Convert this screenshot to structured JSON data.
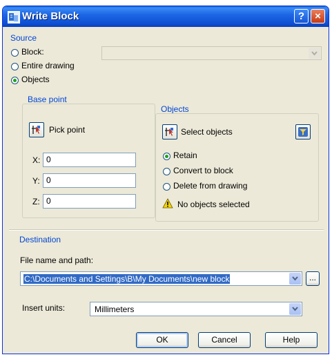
{
  "window": {
    "title": "Write Block",
    "help_label": "?",
    "close_label": "×"
  },
  "source": {
    "title": "Source",
    "options": [
      {
        "label": "Block:",
        "checked": false
      },
      {
        "label": "Entire drawing",
        "checked": false
      },
      {
        "label": "Objects",
        "checked": true
      }
    ],
    "block_combo_value": ""
  },
  "base_point": {
    "title": "Base point",
    "pick_label": "Pick point",
    "x_label": "X:",
    "y_label": "Y:",
    "z_label": "Z:",
    "x_value": "0",
    "y_value": "0",
    "z_value": "0"
  },
  "objects": {
    "title": "Objects",
    "select_label": "Select objects",
    "options": [
      {
        "label": "Retain",
        "checked": true
      },
      {
        "label": "Convert to block",
        "checked": false
      },
      {
        "label": "Delete from drawing",
        "checked": false
      }
    ],
    "status": "No objects selected"
  },
  "destination": {
    "title": "Destination",
    "file_label": "File name and path:",
    "file_value": "C:\\Documents and Settings\\B\\My Documents\\new block",
    "browse_label": "...",
    "units_label": "Insert units:",
    "units_value": "Millimeters"
  },
  "buttons": {
    "ok": "OK",
    "cancel": "Cancel",
    "help": "Help"
  },
  "colors": {
    "accent": "#0046d5",
    "titlebar": "#0d4fd2",
    "selection": "#316ac5",
    "radio_dot": "#21a121"
  }
}
